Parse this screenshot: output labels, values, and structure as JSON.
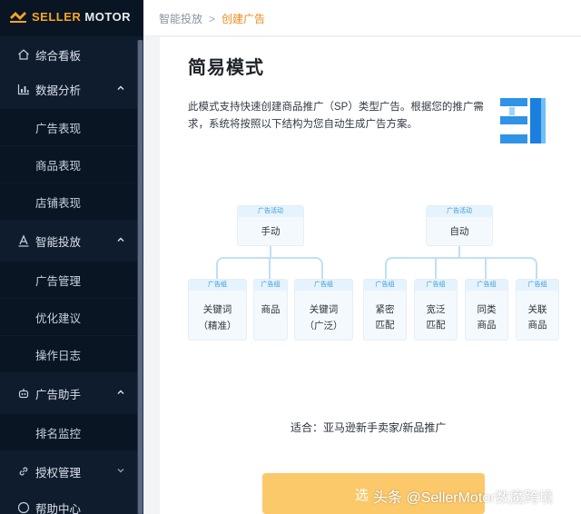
{
  "app": {
    "logo_brand": "SELLER",
    "logo_suffix": "MOTOR"
  },
  "breadcrumb": {
    "parent": "智能投放",
    "separator": ">",
    "current": "创建广告"
  },
  "sidebar": {
    "items": [
      {
        "label": "综合看板",
        "icon": "home-icon",
        "type": "group",
        "chevron": ""
      },
      {
        "label": "数据分析",
        "icon": "bar-chart-icon",
        "type": "group",
        "chevron": "up"
      },
      {
        "label": "广告表现",
        "type": "sub"
      },
      {
        "label": "商品表现",
        "type": "sub"
      },
      {
        "label": "店铺表现",
        "type": "sub"
      },
      {
        "label": "智能投放",
        "icon": "letter-a-icon",
        "type": "group",
        "chevron": "up"
      },
      {
        "label": "广告管理",
        "type": "sub"
      },
      {
        "label": "优化建议",
        "type": "sub"
      },
      {
        "label": "操作日志",
        "type": "sub"
      },
      {
        "label": "广告助手",
        "icon": "robot-icon",
        "type": "group",
        "chevron": "up"
      },
      {
        "label": "排名监控",
        "type": "sub"
      },
      {
        "label": "授权管理",
        "icon": "link-icon",
        "type": "group",
        "chevron": "down"
      },
      {
        "label": "帮助中心",
        "icon": "help-icon",
        "type": "group",
        "chevron": ""
      }
    ]
  },
  "main": {
    "title": "简易模式",
    "description": "此模式支持快速创建商品推广（SP）类型广告。根据您的推广需求，系统将按照以下结构为您自动生成广告方案。",
    "diagram": {
      "campaign_tag": "广告活动",
      "group_tag": "广告组",
      "campaigns": [
        {
          "label": "手动",
          "groups": [
            [
              "关键词",
              "（精准）"
            ],
            [
              "商品"
            ],
            [
              "关键词",
              "（广泛）"
            ]
          ]
        },
        {
          "label": "自动",
          "groups": [
            [
              "紧密",
              "匹配"
            ],
            [
              "宽泛",
              "匹配"
            ],
            [
              "同类",
              "商品"
            ],
            [
              "关联",
              "商品"
            ]
          ]
        }
      ]
    },
    "fit_text": "适合：亚马逊新手卖家/新品推广",
    "cta_label": "选",
    "watermark": "头条 @SellerMotor数魔跨境"
  },
  "colors": {
    "accent": "#f08c1a",
    "sidebar_bg": "#0f1c2e",
    "cta": "#fbc86a",
    "diagram_line": "#bfe0f5"
  }
}
